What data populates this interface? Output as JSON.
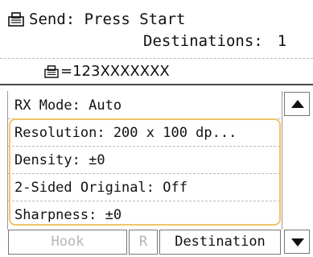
{
  "status": {
    "send_text": "Send: Press Start",
    "destinations_label": "Destinations:",
    "destinations_count": "1"
  },
  "number": {
    "value": "=123XXXXXXX"
  },
  "settings": {
    "items": [
      {
        "label": "RX Mode: Auto"
      },
      {
        "label": "Resolution: 200 x 100 dp..."
      },
      {
        "label": "Density: ±0"
      },
      {
        "label": "2-Sided Original: Off"
      },
      {
        "label": "Sharpness: ±0"
      }
    ]
  },
  "bottom": {
    "hook_label": "Hook",
    "r_label": "R",
    "destination_label": "Destination"
  },
  "icons": {
    "fax": "fax-icon",
    "scroll_up": "scroll-up-icon",
    "scroll_down": "scroll-down-icon"
  },
  "colors": {
    "highlight": "#f2c46a",
    "disabled_text": "#b5b5b5"
  }
}
